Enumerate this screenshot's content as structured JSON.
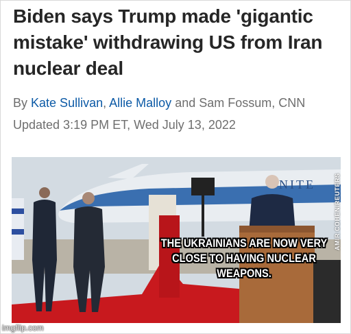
{
  "article": {
    "headline": "Biden says Trump made 'gigantic mistake' withdrawing US from Iran nuclear deal",
    "byline": {
      "prefix": "By",
      "author1": "Kate Sullivan",
      "separator": ",",
      "author2": "Allie Malloy",
      "suffix": "and Sam Fossum, CNN"
    },
    "updated": "Updated 3:19 PM ET, Wed July 13, 2022"
  },
  "photo": {
    "credit": "AMIR COHEN/REUTERS",
    "plane_text": "NITE",
    "meme_caption": "THE UKRAINIANS ARE NOW VERY CLOSE TO HAVING NUCLEAR WEAPONS."
  },
  "watermark": "imgflip.com",
  "colors": {
    "link": "#0c5aa6",
    "headline": "#262626",
    "meta": "#6e6e6e",
    "carpet": "#c8191e",
    "plane_blue": "#3a6fb0"
  }
}
